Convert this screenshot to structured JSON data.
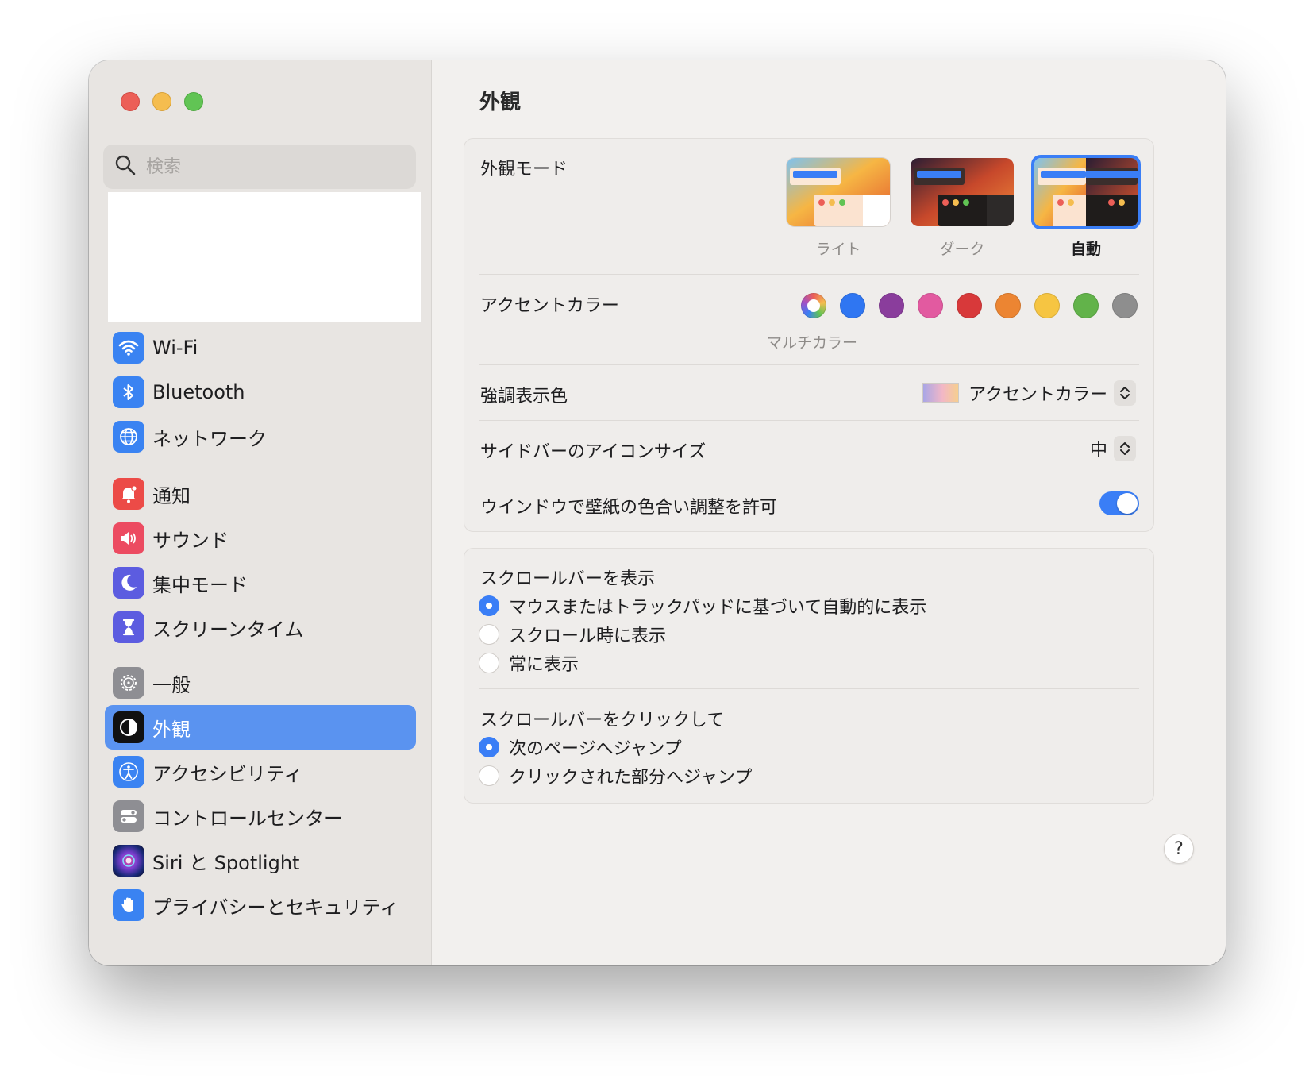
{
  "sidebar": {
    "search_placeholder": "検索",
    "items": [
      {
        "label": "Wi-Fi"
      },
      {
        "label": "Bluetooth"
      },
      {
        "label": "ネットワーク"
      },
      {
        "label": "通知"
      },
      {
        "label": "サウンド"
      },
      {
        "label": "集中モード"
      },
      {
        "label": "スクリーンタイム"
      },
      {
        "label": "一般"
      },
      {
        "label": "外観",
        "selected": true
      },
      {
        "label": "アクセシビリティ"
      },
      {
        "label": "コントロールセンター"
      },
      {
        "label": "Siri と Spotlight"
      },
      {
        "label": "プライバシーとセキュリティ"
      }
    ]
  },
  "main": {
    "title": "外観",
    "appearance_mode": {
      "label": "外観モード",
      "options": [
        {
          "label": "ライト"
        },
        {
          "label": "ダーク"
        },
        {
          "label": "自動",
          "selected": true
        }
      ]
    },
    "accent_color": {
      "label": "アクセントカラー",
      "selected_caption": "マルチカラー",
      "colors": [
        "multicolor",
        "#2f76f2",
        "#8a3d9c",
        "#e25aa0",
        "#d8393a",
        "#ec8532",
        "#f6c542",
        "#62b34a",
        "#8e8e8e"
      ]
    },
    "highlight_color": {
      "label": "強調表示色",
      "value": "アクセントカラー"
    },
    "sidebar_icon_size": {
      "label": "サイドバーのアイコンサイズ",
      "value": "中"
    },
    "wallpaper_tinting": {
      "label": "ウインドウで壁紙の色合い調整を許可",
      "enabled": true
    },
    "show_scrollbars": {
      "label": "スクロールバーを表示",
      "options": [
        {
          "label": "マウスまたはトラックパッドに基づいて自動的に表示",
          "selected": true
        },
        {
          "label": "スクロール時に表示",
          "selected": false
        },
        {
          "label": "常に表示",
          "selected": false
        }
      ]
    },
    "click_scrollbar": {
      "label": "スクロールバーをクリックして",
      "options": [
        {
          "label": "次のページへジャンプ",
          "selected": true
        },
        {
          "label": "クリックされた部分へジャンプ",
          "selected": false
        }
      ]
    },
    "help_label": "?"
  },
  "colors": {
    "accent": "#3a7ef6",
    "selection": "#5a93f0"
  }
}
